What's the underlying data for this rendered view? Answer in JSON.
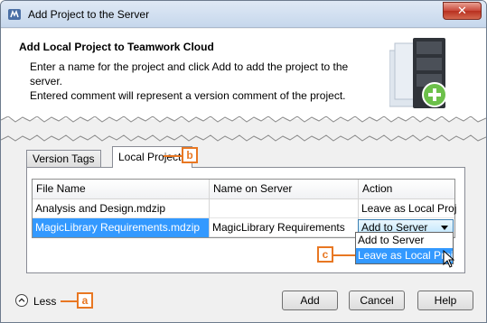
{
  "window": {
    "title": "Add Project to the Server",
    "close_label": "✕"
  },
  "header": {
    "title": "Add Local Project to Teamwork Cloud",
    "description_line1": "Enter a name for the project and click Add to add the project to the server.",
    "description_line2": "Entered comment will represent a version comment of the project."
  },
  "tabs": [
    {
      "label": "Version Tags"
    },
    {
      "label": "Local Projects"
    }
  ],
  "table": {
    "columns": [
      "File Name",
      "Name on Server",
      "Action"
    ],
    "rows": [
      {
        "file": "Analysis and Design.mdzip",
        "server_name": "",
        "action": "Leave as Local Project"
      },
      {
        "file": "MagicLibrary Requirements.mdzip",
        "server_name": "MagicLibrary Requirements",
        "action": "Add to Server"
      }
    ]
  },
  "dropdown": {
    "options": [
      "Add to Server",
      "Leave as Local Project"
    ],
    "highlighted": "Leave as Local Project"
  },
  "callouts": {
    "a": "a",
    "b": "b",
    "c": "c"
  },
  "footer": {
    "less_label": "Less",
    "add_label": "Add",
    "cancel_label": "Cancel",
    "help_label": "Help"
  },
  "colors": {
    "callout": "#e87722",
    "selection": "#3399ff"
  }
}
